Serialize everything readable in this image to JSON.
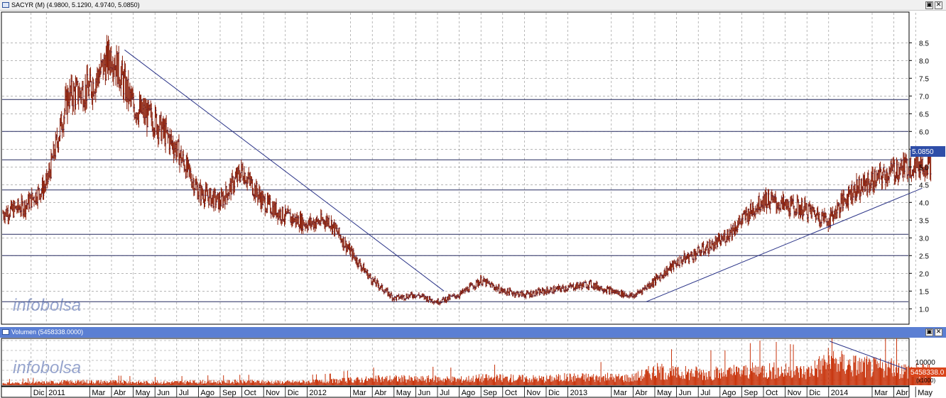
{
  "price_panel": {
    "title": "SACYR (M) (4.9800, 5.1290, 4.9740, 5.0850)",
    "last_value_tag": "5.0850",
    "watermark": "infobolsa",
    "controls": [
      "▣",
      "✕"
    ]
  },
  "volume_panel": {
    "title": "Volumen (5458338.0000)",
    "last_value_tag": "5458338.0",
    "axis_tick": "10000",
    "axis_unit": "(x1000)",
    "watermark": "infobolsa",
    "controls": [
      "▣",
      "✕"
    ]
  },
  "colors": {
    "titlebar_price": "#f0f0f0",
    "titlebar_volume": "#5b7fd3",
    "candle": "#8b1f0a",
    "bar_tick": "#1a2a80",
    "trendline": "#2b3488",
    "hline": "#23285f",
    "grid": "#8a8a8a",
    "volume_bar": "#c8340c",
    "value_tag": "#2f4ea8",
    "volume_tag": "#d9441a"
  },
  "chart_data": [
    {
      "type": "line",
      "title": "SACYR (M) (4.9800, 5.1290, 4.9740, 5.0850)",
      "style": "OHLC bars",
      "grid": true,
      "y_axis_side": "right",
      "ylim": [
        0.4,
        8.9
      ],
      "y_ticks": [
        "1.0",
        "1.5",
        "2.0",
        "2.5",
        "3.0",
        "3.5",
        "4.0",
        "4.5",
        "5.0",
        "5.5",
        "6.0",
        "6.5",
        "7.0",
        "7.5",
        "8.0",
        "8.5"
      ],
      "x_tick_labels": [
        "Dic",
        "2011",
        "Mar",
        "Abr",
        "May",
        "Jun",
        "Jul",
        "Ago",
        "Sep",
        "Oct",
        "Nov",
        "Dic",
        "2012",
        "Mar",
        "Abr",
        "May",
        "Jun",
        "Jul",
        "Ago",
        "Sep",
        "Oct",
        "Nov",
        "Dic",
        "2013",
        "Mar",
        "Abr",
        "May",
        "Jun",
        "Jul",
        "Ago",
        "Sep",
        "Oct",
        "Nov",
        "Dic",
        "2014",
        "Mar",
        "Abr",
        "May"
      ],
      "x": [
        "2010-11",
        "2010-12",
        "2011-01",
        "2011-02",
        "2011-03",
        "2011-04",
        "2011-05",
        "2011-06",
        "2011-07",
        "2011-08",
        "2011-09",
        "2011-10",
        "2011-11",
        "2011-12",
        "2012-01",
        "2012-02",
        "2012-03",
        "2012-04",
        "2012-05",
        "2012-06",
        "2012-07",
        "2012-08",
        "2012-09",
        "2012-10",
        "2012-11",
        "2012-12",
        "2013-01",
        "2013-02",
        "2013-03",
        "2013-04",
        "2013-05",
        "2013-06",
        "2013-07",
        "2013-08",
        "2013-09",
        "2013-10",
        "2013-11",
        "2013-12",
        "2014-01",
        "2014-02",
        "2014-03",
        "2014-04",
        "2014-05"
      ],
      "series": [
        {
          "values": [
            3.7,
            3.9,
            4.5,
            7.0,
            7.2,
            8.2,
            6.7,
            6.3,
            5.5,
            4.3,
            4.0,
            4.9,
            4.0,
            3.6,
            3.4,
            3.5,
            2.6,
            1.8,
            1.3,
            1.4,
            1.2,
            1.4,
            1.8,
            1.5,
            1.4,
            1.5,
            1.6,
            1.7,
            1.5,
            1.35,
            1.8,
            2.3,
            2.6,
            2.9,
            3.5,
            4.1,
            3.9,
            3.8,
            3.5,
            4.3,
            4.6,
            4.9,
            5.08
          ]
        }
      ],
      "horizontal_lines": [
        1.2,
        2.5,
        3.1,
        4.35,
        5.2,
        6.0,
        6.9
      ],
      "trendlines": [
        {
          "from": [
            "2011-04",
            8.3
          ],
          "to": [
            "2012-07",
            1.5
          ]
        },
        {
          "from": [
            "2013-04",
            1.2
          ],
          "to": [
            "2014-05",
            4.4
          ]
        }
      ]
    },
    {
      "type": "bar",
      "title": "Volumen (5458338.0000)",
      "grid": true,
      "y_axis_side": "right",
      "y_ticks": [
        "10000"
      ],
      "yunit": "(x1000)",
      "x": [
        "2010-11",
        "2010-12",
        "2011-01",
        "2011-02",
        "2011-03",
        "2011-04",
        "2011-05",
        "2011-06",
        "2011-07",
        "2011-08",
        "2011-09",
        "2011-10",
        "2011-11",
        "2011-12",
        "2012-01",
        "2012-02",
        "2012-03",
        "2012-04",
        "2012-05",
        "2012-06",
        "2012-07",
        "2012-08",
        "2012-09",
        "2012-10",
        "2012-11",
        "2012-12",
        "2013-01",
        "2013-02",
        "2013-03",
        "2013-04",
        "2013-05",
        "2013-06",
        "2013-07",
        "2013-08",
        "2013-09",
        "2013-10",
        "2013-11",
        "2013-12",
        "2014-01",
        "2014-02",
        "2014-03",
        "2014-04",
        "2014-05"
      ],
      "series": [
        {
          "values": [
            800,
            900,
            1100,
            1300,
            1400,
            1300,
            1200,
            1100,
            1200,
            1300,
            1300,
            1400,
            1300,
            1200,
            1400,
            1500,
            2000,
            2300,
            2600,
            2300,
            2500,
            2200,
            2800,
            2700,
            2600,
            2500,
            3000,
            3100,
            3000,
            2900,
            5500,
            4600,
            4800,
            4500,
            5200,
            6000,
            5500,
            5200,
            9500,
            8000,
            7000,
            6500,
            5500
          ]
        }
      ],
      "trendline": {
        "from": [
          "2014-01",
          15000
        ],
        "to": [
          "2014-05",
          5458
        ]
      }
    }
  ]
}
